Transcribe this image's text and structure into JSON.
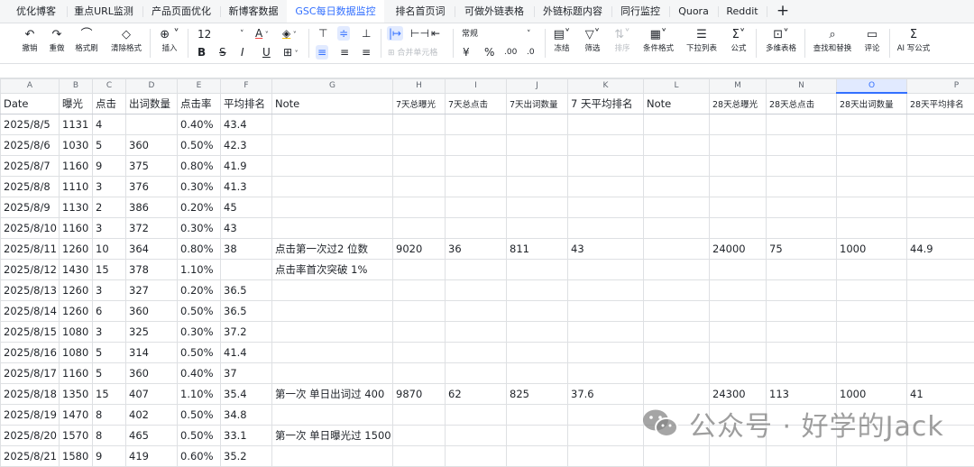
{
  "tabs": [
    {
      "label": "优化博客"
    },
    {
      "label": "重点URL监测"
    },
    {
      "label": "产品页面优化"
    },
    {
      "label": "新博客数据"
    },
    {
      "label": "GSC每日数据监控"
    },
    {
      "label": "排名首页词"
    },
    {
      "label": "可做外链表格"
    },
    {
      "label": "外链标题内容"
    },
    {
      "label": "同行监控"
    },
    {
      "label": "Quora"
    },
    {
      "label": "Reddit"
    }
  ],
  "toolbar": {
    "undo": "撤销",
    "redo": "重做",
    "format_painter": "格式刷",
    "clear_format": "清除格式",
    "insert": "插入",
    "font_size": "12",
    "merge_cells": "合并单元格",
    "number_format": "常规",
    "currency": "¥",
    "percent": "%",
    "decimal": ".00",
    "freeze": "冻结",
    "filter": "筛选",
    "sort": "排序",
    "conditional_format": "条件格式",
    "dropdown": "下拉列表",
    "formula": "公式",
    "pivot": "多维表格",
    "find_replace": "查找和替换",
    "comment": "评论",
    "ai_formula": "AI 写公式",
    "bold": "B",
    "italic": "I",
    "underline": "U",
    "strike": "S",
    "text_a": "A"
  },
  "sheet": {
    "columns": [
      "A",
      "B",
      "C",
      "D",
      "E",
      "F",
      "G",
      "H",
      "I",
      "J",
      "K",
      "L",
      "M",
      "N",
      "O",
      "P"
    ],
    "selected_column": "O",
    "headers": [
      "Date",
      "曝光",
      "点击",
      "出词数量",
      "点击率",
      "平均排名",
      "Note",
      "7天总曝光",
      "7天总点击",
      "7天出词数量",
      "7 天平均排名",
      "Note",
      "28天总曝光",
      "28天总点击",
      "28天出词数量",
      "28天平均排名"
    ],
    "rows": [
      [
        "2025/8/5",
        "1131",
        "4",
        "",
        "0.40%",
        "43.4",
        "",
        "",
        "",
        "",
        "",
        "",
        "",
        "",
        "",
        ""
      ],
      [
        "2025/8/6",
        "1030",
        "5",
        "360",
        "0.50%",
        "42.3",
        "",
        "",
        "",
        "",
        "",
        "",
        "",
        "",
        "",
        ""
      ],
      [
        "2025/8/7",
        "1160",
        "9",
        "375",
        "0.80%",
        "41.9",
        "",
        "",
        "",
        "",
        "",
        "",
        "",
        "",
        "",
        ""
      ],
      [
        "2025/8/8",
        "1110",
        "3",
        "376",
        "0.30%",
        "41.3",
        "",
        "",
        "",
        "",
        "",
        "",
        "",
        "",
        "",
        ""
      ],
      [
        "2025/8/9",
        "1130",
        "2",
        "386",
        "0.20%",
        "45",
        "",
        "",
        "",
        "",
        "",
        "",
        "",
        "",
        "",
        ""
      ],
      [
        "2025/8/10",
        "1160",
        "3",
        "372",
        "0.30%",
        "43",
        "",
        "",
        "",
        "",
        "",
        "",
        "",
        "",
        "",
        ""
      ],
      [
        "2025/8/11",
        "1260",
        "10",
        "364",
        "0.80%",
        "38",
        "点击第一次过2 位数",
        "9020",
        "36",
        "811",
        "43",
        "",
        "24000",
        "75",
        "1000",
        "44.9"
      ],
      [
        "2025/8/12",
        "1430",
        "15",
        "378",
        "1.10%",
        "",
        "点击率首次突破 1%",
        "",
        "",
        "",
        "",
        "",
        "",
        "",
        "",
        ""
      ],
      [
        "2025/8/13",
        "1260",
        "3",
        "327",
        "0.20%",
        "36.5",
        "",
        "",
        "",
        "",
        "",
        "",
        "",
        "",
        "",
        ""
      ],
      [
        "2025/8/14",
        "1260",
        "6",
        "360",
        "0.50%",
        "36.5",
        "",
        "",
        "",
        "",
        "",
        "",
        "",
        "",
        "",
        ""
      ],
      [
        "2025/8/15",
        "1080",
        "3",
        "325",
        "0.30%",
        "37.2",
        "",
        "",
        "",
        "",
        "",
        "",
        "",
        "",
        "",
        ""
      ],
      [
        "2025/8/16",
        "1080",
        "5",
        "314",
        "0.50%",
        "41.4",
        "",
        "",
        "",
        "",
        "",
        "",
        "",
        "",
        "",
        ""
      ],
      [
        "2025/8/17",
        "1160",
        "5",
        "360",
        "0.40%",
        "37",
        "",
        "",
        "",
        "",
        "",
        "",
        "",
        "",
        "",
        ""
      ],
      [
        "2025/8/18",
        "1350",
        "15",
        "407",
        "1.10%",
        "35.4",
        "第一次 单日出词过 400",
        "9870",
        "62",
        "825",
        "37.6",
        "",
        "24300",
        "113",
        "1000",
        "41"
      ],
      [
        "2025/8/19",
        "1470",
        "8",
        "402",
        "0.50%",
        "34.8",
        "",
        "",
        "",
        "",
        "",
        "",
        "",
        "",
        "",
        ""
      ],
      [
        "2025/8/20",
        "1570",
        "8",
        "465",
        "0.50%",
        "33.1",
        "第一次 单日曝光过 1500",
        "",
        "",
        "",
        "",
        "",
        "",
        "",
        "",
        ""
      ],
      [
        "2025/8/21",
        "1580",
        "9",
        "419",
        "0.60%",
        "35.2",
        "",
        "",
        "",
        "",
        "",
        "",
        "",
        "",
        "",
        ""
      ]
    ]
  },
  "watermark": {
    "text": "公众号 · 好学的Jack"
  },
  "colors": {
    "accent": "#3370ff",
    "grid": "#dee0e3",
    "header_bg": "#f5f6f7"
  }
}
